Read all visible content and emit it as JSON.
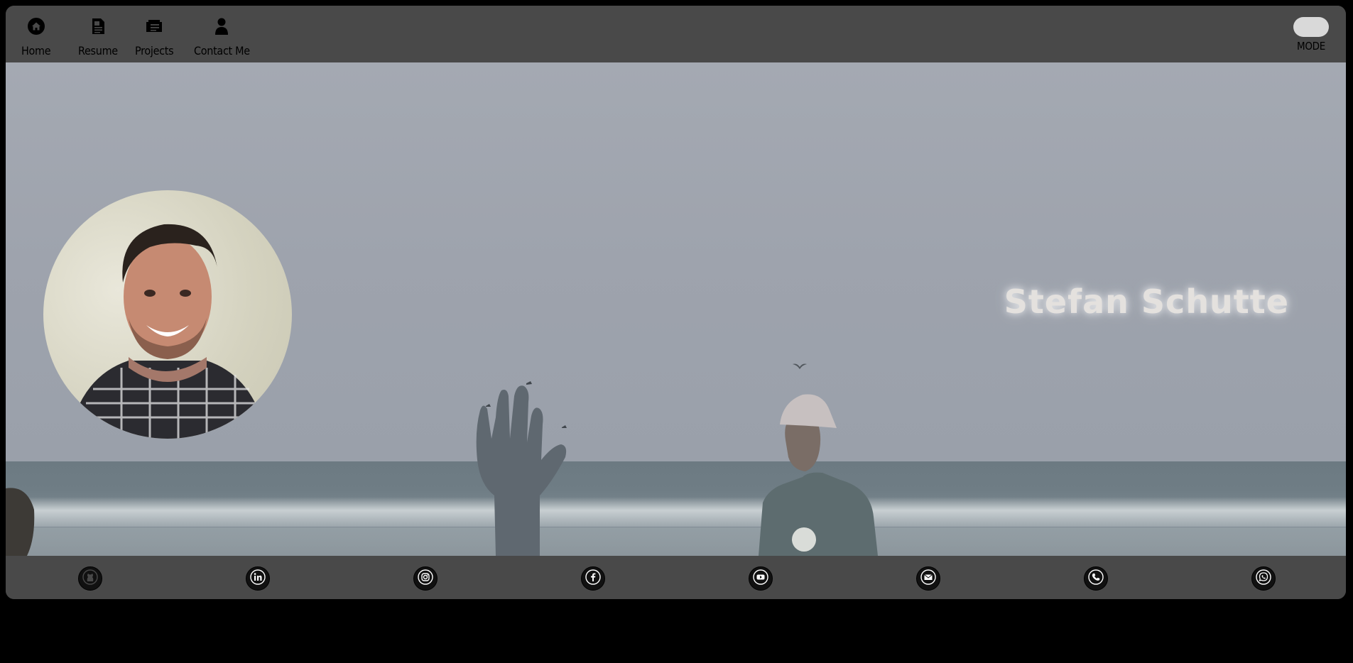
{
  "nav": {
    "items": [
      {
        "label": "Home",
        "icon": "home-icon"
      },
      {
        "label": "Resume",
        "icon": "resume-icon"
      },
      {
        "label": "Projects",
        "icon": "projects-icon"
      },
      {
        "label": "Contact Me",
        "icon": "contact-icon"
      }
    ],
    "mode_label": "MODE"
  },
  "hero": {
    "name": "Stefan Schutte"
  },
  "social": [
    {
      "icon": "github-icon"
    },
    {
      "icon": "linkedin-icon"
    },
    {
      "icon": "instagram-icon"
    },
    {
      "icon": "facebook-icon"
    },
    {
      "icon": "youtube-icon"
    },
    {
      "icon": "email-icon"
    },
    {
      "icon": "phone-icon"
    },
    {
      "icon": "whatsapp-icon"
    }
  ],
  "colors": {
    "bar_background": "#494949",
    "page_background": "#000000",
    "name_text": "#e4e1de"
  }
}
